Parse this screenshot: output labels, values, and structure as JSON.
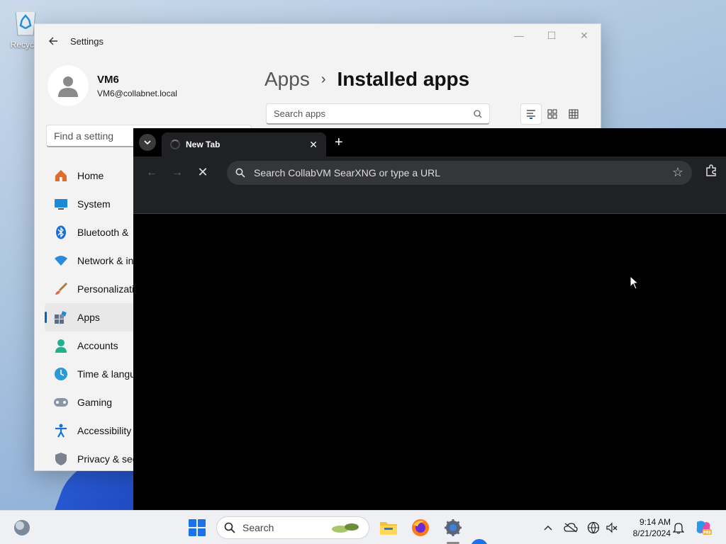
{
  "desktop": {
    "recycle_bin_label": "Recycle"
  },
  "settings": {
    "app_title": "Settings",
    "user": {
      "name": "VM6",
      "email": "VM6@collabnet.local"
    },
    "find_setting_placeholder": "Find a setting",
    "nav": [
      {
        "label": "Home",
        "icon": "home-icon"
      },
      {
        "label": "System",
        "icon": "monitor-icon"
      },
      {
        "label": "Bluetooth &",
        "icon": "bluetooth-icon"
      },
      {
        "label": "Network & in",
        "icon": "wifi-icon"
      },
      {
        "label": "Personalizatio",
        "icon": "brush-icon"
      },
      {
        "label": "Apps",
        "icon": "apps-icon"
      },
      {
        "label": "Accounts",
        "icon": "person-icon"
      },
      {
        "label": "Time & langu",
        "icon": "globe-clock-icon"
      },
      {
        "label": "Gaming",
        "icon": "gamepad-icon"
      },
      {
        "label": "Accessibility",
        "icon": "accessibility-icon"
      },
      {
        "label": "Privacy & sec",
        "icon": "shield-icon"
      }
    ],
    "active_nav": "Apps",
    "breadcrumb": {
      "parent": "Apps",
      "separator": "›",
      "current": "Installed apps"
    },
    "search_apps_placeholder": "Search apps",
    "view_modes": [
      "list-view-icon",
      "tile-view-icon",
      "grid-view-icon"
    ]
  },
  "browser": {
    "tab": {
      "title": "New Tab"
    },
    "omnibox_placeholder": "Search CollabVM SearXNG or type a URL"
  },
  "taskbar": {
    "search_label": "Search",
    "clock": {
      "time": "9:14 AM",
      "date": "8/21/2024"
    }
  },
  "colors": {
    "accent": "#0067c0",
    "start_blue": "#1a73e8",
    "browser_chrome": "#202124",
    "omnibox": "#35363a"
  }
}
